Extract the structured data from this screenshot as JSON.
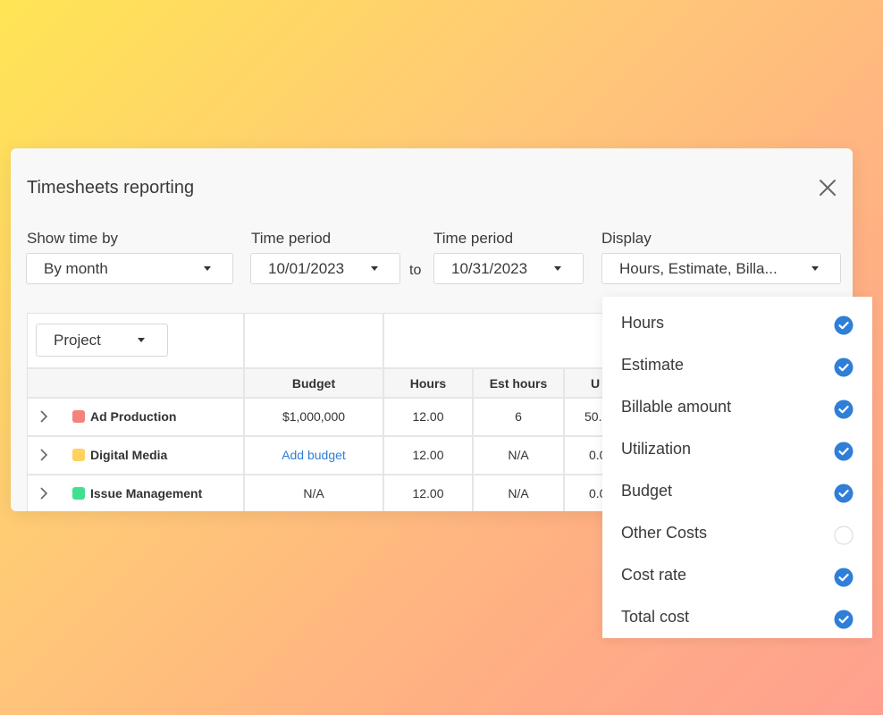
{
  "dialog": {
    "title": "Timesheets reporting",
    "filters": {
      "show_time_by": {
        "label": "Show time by",
        "value": "By month"
      },
      "period_start": {
        "label": "Time period",
        "value": "10/01/2023"
      },
      "to_text": "to",
      "period_end": {
        "label": "Time period",
        "value": "10/31/2023"
      },
      "display": {
        "label": "Display",
        "value": "Hours, Estimate, Billa..."
      }
    },
    "table": {
      "group_by": "Project",
      "columns": [
        "Budget",
        "Hours",
        "Est hours",
        "U"
      ],
      "rows": [
        {
          "name": "Ad Production",
          "color": "#f4837a",
          "budget": "$1,000,000",
          "budget_is_link": false,
          "hours": "12.00",
          "est_hours": "6",
          "extra": "50."
        },
        {
          "name": "Digital Media",
          "color": "#ffd25c",
          "budget": "Add budget",
          "budget_is_link": true,
          "hours": "12.00",
          "est_hours": "N/A",
          "extra": "0.0"
        },
        {
          "name": "Issue Management",
          "color": "#3fe08f",
          "budget": "N/A",
          "budget_is_link": false,
          "hours": "12.00",
          "est_hours": "N/A",
          "extra": "0.0"
        }
      ]
    }
  },
  "display_menu": {
    "items": [
      {
        "label": "Hours",
        "checked": true
      },
      {
        "label": "Estimate",
        "checked": true
      },
      {
        "label": "Billable amount",
        "checked": true
      },
      {
        "label": "Utilization",
        "checked": true
      },
      {
        "label": "Budget",
        "checked": true
      },
      {
        "label": "Other Costs",
        "checked": false
      },
      {
        "label": "Cost rate",
        "checked": true
      },
      {
        "label": "Total cost",
        "checked": true
      }
    ],
    "check_color": "#2f7ed8"
  }
}
